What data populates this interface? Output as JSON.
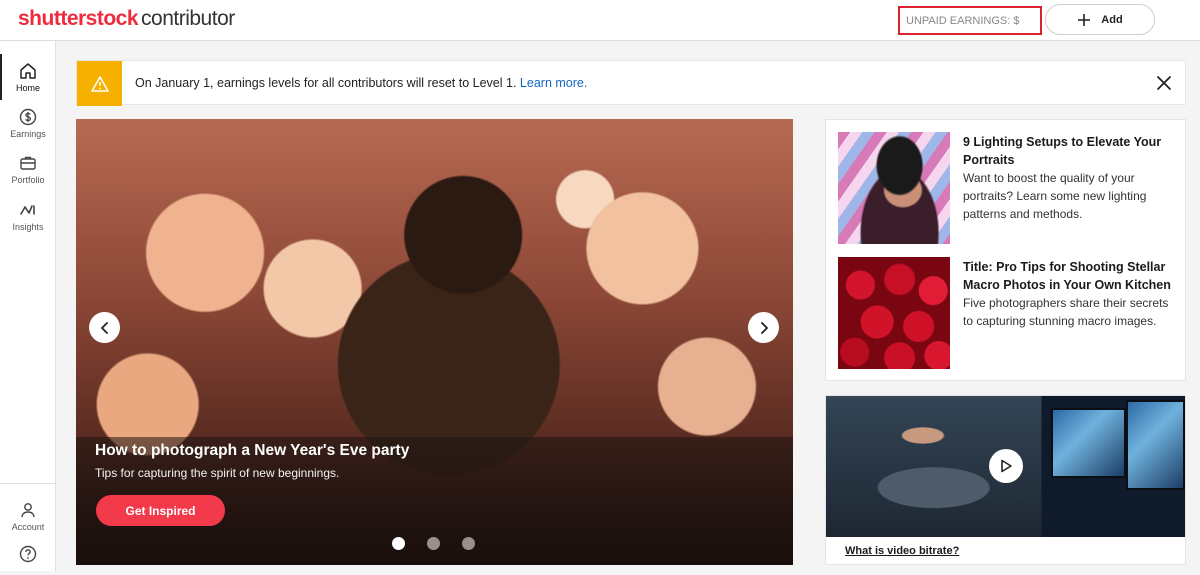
{
  "header": {
    "logo_brand": "shutterstock",
    "logo_sub": "contributor",
    "earnings_label": "UNPAID EARNINGS: $",
    "add_label": "Add"
  },
  "sidebar": {
    "items": [
      {
        "label": "Home",
        "icon": "home-icon"
      },
      {
        "label": "Earnings",
        "icon": "dollar-icon"
      },
      {
        "label": "Portfolio",
        "icon": "briefcase-icon"
      },
      {
        "label": "Insights",
        "icon": "insights-icon"
      }
    ],
    "account_label": "Account",
    "help_icon": "help-icon"
  },
  "banner": {
    "text": "On January 1, earnings levels for all contributors will reset to Level 1.",
    "link": "Learn more.",
    "warning_icon": "warning-icon",
    "close_icon": "close-icon"
  },
  "hero": {
    "title": "How to photograph a New Year's Eve party",
    "subtitle": "Tips for capturing the spirit of new beginnings.",
    "button_label": "Get Inspired",
    "slides": 3,
    "active_slide": 1
  },
  "articles": [
    {
      "title": "9 Lighting Setups to Elevate Your Portraits",
      "description": "Want to boost the quality of your portraits? Learn some new lighting patterns and methods."
    },
    {
      "title": "Title: Pro Tips for Shooting Stellar Macro Photos in Your Own Kitchen",
      "description": "Five photographers share their secrets to capturing stunning macro images."
    }
  ],
  "video": {
    "caption": "What is video bitrate?",
    "play_icon": "play-icon"
  },
  "colors": {
    "brand_red": "#ef2b3d",
    "highlight_border": "#d9212f",
    "warning": "#f6b000",
    "link": "#1466c0",
    "cta": "#f23a4b"
  }
}
